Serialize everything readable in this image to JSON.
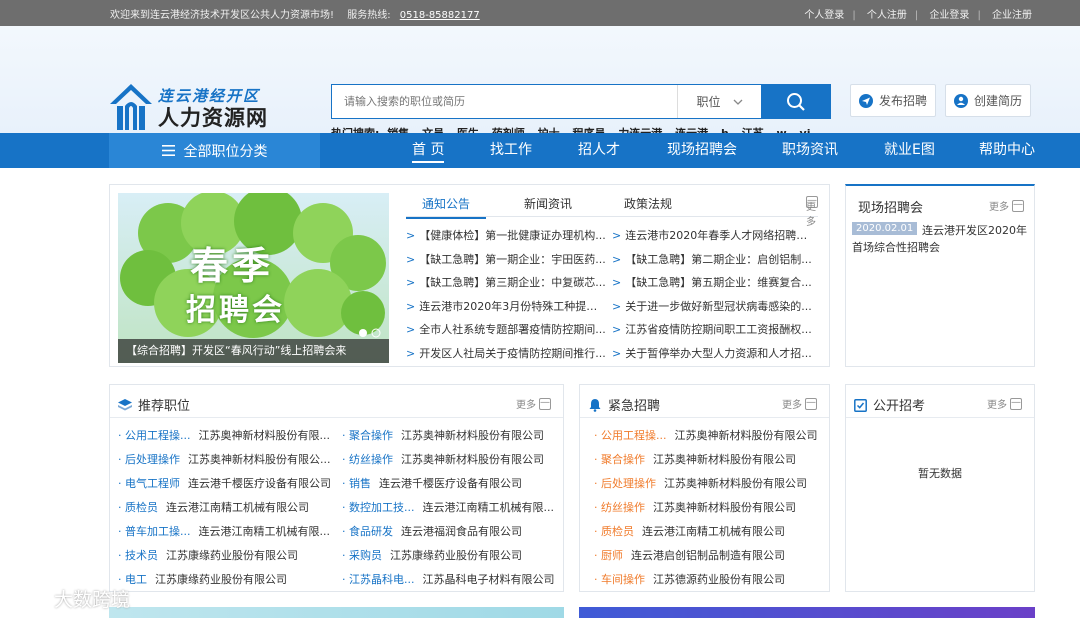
{
  "topbar": {
    "welcome": "欢迎来到连云港经济技术开发区公共人力资源市场!",
    "hotline_label": "服务热线:",
    "hotline": "0518-85882177",
    "links": [
      "个人登录",
      "个人注册",
      "企业登录",
      "企业注册"
    ]
  },
  "logo": {
    "line1": "连云港经开区",
    "line2": "人力资源网"
  },
  "search": {
    "placeholder": "请输入搜索的职位或简历",
    "type": "职位"
  },
  "hot": {
    "label": "热门搜索:",
    "words": [
      "销售",
      "文员",
      "医生",
      "药剂师",
      "护士",
      "程序员",
      "力连云港",
      "连云港",
      "h",
      "江苏",
      "w",
      "yi"
    ]
  },
  "header_buttons": {
    "publish": "发布招聘",
    "resume": "创建简历"
  },
  "nav": {
    "all": "全部职位分类",
    "items": [
      "首 页",
      "找工作",
      "招人才",
      "现场招聘会",
      "职场资讯",
      "就业E图",
      "帮助中心"
    ]
  },
  "banner": {
    "caption": "【综合招聘】开发区“春风行动”线上招聘会来",
    "title1": "春季",
    "title2": "招聘会"
  },
  "tabs": [
    "通知公告",
    "新闻资讯",
    "政策法规"
  ],
  "more": "更多",
  "news": [
    [
      "【健康体检】第一批健康证办理机构...",
      "连云港市2020年春季人才网络招聘会..."
    ],
    [
      "【缺工急聘】第一期企业：宇田医药...",
      "【缺工急聘】第二期企业：启创铝制..."
    ],
    [
      "【缺工急聘】第三期企业：中复碳芯...",
      "【缺工急聘】第五期企业：维赛复合..."
    ],
    [
      "连云港市2020年3月份特殊工种提前...",
      "关于进一步做好新型冠状病毒感染的..."
    ],
    [
      "全市人社系统专题部署疫情防控期间...",
      "江苏省疫情防控期间职工工资报酬权..."
    ],
    [
      "开发区人社局关于疫情防控期间推行...",
      "关于暂停举办大型人力资源和人才招..."
    ]
  ],
  "fair": {
    "title": "现场招聘会",
    "date": "2020.02.01",
    "name": "连云港开发区2020年首场综合性招聘会"
  },
  "recommend": {
    "title": "推荐职位",
    "rows": [
      [
        [
          "公用工程操...",
          "江苏奥神新材料股份有限..."
        ],
        [
          "聚合操作",
          "江苏奥神新材料股份有限公司"
        ]
      ],
      [
        [
          "后处理操作",
          "江苏奥神新材料股份有限公..."
        ],
        [
          "纺丝操作",
          "江苏奥神新材料股份有限公司"
        ]
      ],
      [
        [
          "电气工程师",
          "连云港千樱医疗设备有限公司"
        ],
        [
          "销售",
          "连云港千樱医疗设备有限公司"
        ]
      ],
      [
        [
          "质检员",
          "连云港江南精工机械有限公司"
        ],
        [
          "数控加工技...",
          "连云港江南精工机械有限..."
        ]
      ],
      [
        [
          "普车加工操...",
          "连云港江南精工机械有限..."
        ],
        [
          "食品研发",
          "连云港福润食品有限公司"
        ]
      ],
      [
        [
          "技术员",
          "江苏康缘药业股份有限公司"
        ],
        [
          "采购员",
          "江苏康缘药业股份有限公司"
        ]
      ],
      [
        [
          "电工",
          "江苏康缘药业股份有限公司"
        ],
        [
          "江苏晶科电...",
          "江苏晶科电子材料有限公司"
        ]
      ]
    ]
  },
  "urgent": {
    "title": "紧急招聘",
    "rows": [
      [
        "公用工程操...",
        "江苏奥神新材料股份有限公司"
      ],
      [
        "聚合操作",
        "江苏奥神新材料股份有限公司"
      ],
      [
        "后处理操作",
        "江苏奥神新材料股份有限公司"
      ],
      [
        "纺丝操作",
        "江苏奥神新材料股份有限公司"
      ],
      [
        "质检员",
        "连云港江南精工机械有限公司"
      ],
      [
        "厨师",
        "连云港启创铝制品制造有限公司"
      ],
      [
        "车间操作",
        "江苏德源药业股份有限公司"
      ]
    ]
  },
  "exam": {
    "title": "公开招考",
    "empty": "暂无数据"
  },
  "watermark": "大数跨境",
  "colors": {
    "primary": "#1773c6",
    "accent": "#f07b2b"
  }
}
